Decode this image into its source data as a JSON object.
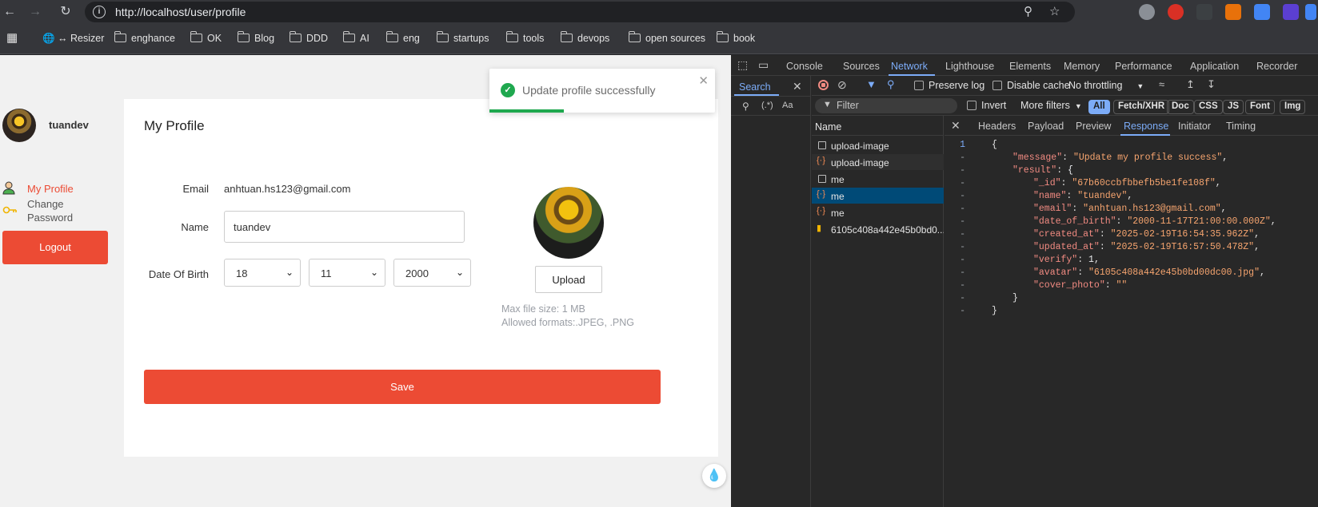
{
  "browser": {
    "url": "http://localhost/user/profile",
    "bookmarks": [
      "↔ Resizer",
      "enghance",
      "OK",
      "Blog",
      "DDD",
      "AI",
      "eng",
      "startups",
      "tools",
      "devops",
      "open sources",
      "book"
    ]
  },
  "sidebar": {
    "username": "tuandev",
    "items": [
      {
        "label": "My Profile",
        "active": true
      },
      {
        "label": "Change",
        "label2": "Password",
        "active": false
      }
    ],
    "logout": "Logout"
  },
  "profile": {
    "title": "My Profile",
    "email_label": "Email",
    "email_value": "anhtuan.hs123@gmail.com",
    "name_label": "Name",
    "name_value": "tuandev",
    "dob_label": "Date Of Birth",
    "dob_day": "18",
    "dob_month": "11",
    "dob_year": "2000",
    "upload_label": "Upload",
    "max_size": "Max file size: 1 MB",
    "formats": "Allowed formats:.JPEG, .PNG",
    "save_label": "Save"
  },
  "toast": {
    "message": "Update profile successfully",
    "progress": 0.33
  },
  "devtools": {
    "tabs": [
      "Console",
      "Sources",
      "Network",
      "Lighthouse",
      "Elements",
      "Memory",
      "Performance",
      "Application",
      "Recorder"
    ],
    "active_tab": "Network",
    "search_tab": "Search",
    "preserve_log": "Preserve log",
    "disable_cache": "Disable cache",
    "throttling": "No throttling",
    "filter_placeholder": "Filter",
    "invert": "Invert",
    "more_filters": "More filters",
    "filter_pills": [
      "All",
      "Fetch/XHR",
      "Doc",
      "CSS",
      "JS",
      "Font",
      "Img"
    ],
    "name_header": "Name",
    "requests": [
      "upload-image",
      "upload-image",
      "me",
      "me",
      "me",
      "6105c408a442e45b0bd0..."
    ],
    "detail_tabs": [
      "Headers",
      "Payload",
      "Preview",
      "Response",
      "Initiator",
      "Timing"
    ],
    "active_detail_tab": "Response",
    "response_lines": [
      {
        "ln": "1",
        "text": "{"
      },
      {
        "ln": "-",
        "key": "\"message\"",
        "val": "\"Update my profile success\"",
        "end": ","
      },
      {
        "ln": "-",
        "key": "\"result\"",
        "val": "{",
        "end": ""
      },
      {
        "ln": "-",
        "key": "\"_id\"",
        "val": "\"67b60ccbfbbefb5be1fe108f\"",
        "end": ","
      },
      {
        "ln": "-",
        "key": "\"name\"",
        "val": "\"tuandev\"",
        "end": ","
      },
      {
        "ln": "-",
        "key": "\"email\"",
        "val": "\"anhtuan.hs123@gmail.com\"",
        "end": ","
      },
      {
        "ln": "-",
        "key": "\"date_of_birth\"",
        "val": "\"2000-11-17T21:00:00.000Z\"",
        "end": ","
      },
      {
        "ln": "-",
        "key": "\"created_at\"",
        "val": "\"2025-02-19T16:54:35.962Z\"",
        "end": ","
      },
      {
        "ln": "-",
        "key": "\"updated_at\"",
        "val": "\"2025-02-19T16:57:50.478Z\"",
        "end": ","
      },
      {
        "ln": "-",
        "key": "\"verify\"",
        "val": "1",
        "end": ","
      },
      {
        "ln": "-",
        "key": "\"avatar\"",
        "val": "\"6105c408a442e45b0bd00dc00.jpg\"",
        "end": ","
      },
      {
        "ln": "-",
        "key": "\"cover_photo\"",
        "val": "\"\"",
        "end": ""
      },
      {
        "ln": "-",
        "text": "}"
      },
      {
        "ln": "-",
        "text": "}"
      }
    ]
  },
  "colors": {
    "accent": "#ec4b34",
    "success": "#1fa84f",
    "devtools_accent": "#7cacf8"
  }
}
